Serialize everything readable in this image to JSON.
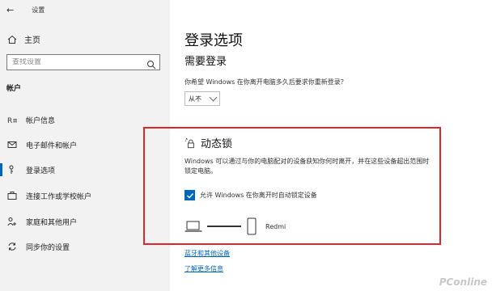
{
  "window": {
    "title": "设置"
  },
  "sidebar": {
    "home_label": "主页",
    "search_placeholder": "查找设置",
    "section_label": "帐户",
    "items": [
      {
        "label": "帐户信息",
        "icon": "person-card-icon",
        "active": false
      },
      {
        "label": "电子邮件和帐户",
        "icon": "mail-icon",
        "active": false
      },
      {
        "label": "登录选项",
        "icon": "key-icon",
        "active": true
      },
      {
        "label": "连接工作或学校帐户",
        "icon": "briefcase-icon",
        "active": false
      },
      {
        "label": "家庭和其他用户",
        "icon": "people-icon",
        "active": false
      },
      {
        "label": "同步你的设置",
        "icon": "sync-icon",
        "active": false
      }
    ]
  },
  "main": {
    "title": "登录选项",
    "require_signin": {
      "title": "需要登录",
      "question": "你希望 Windows 在你离开电脑多久后要求你重新登录？",
      "selected": "从不"
    },
    "dynamic_lock": {
      "title": "动态锁",
      "description": "Windows 可以通过与你的电脑配对的设备获知你何时离开，并在这些设备超出范围时锁定电脑。",
      "checkbox_label": "允许 Windows 在你离开时自动锁定设备",
      "checked": true,
      "device_name": "Redmi"
    },
    "links": {
      "bluetooth": "蓝牙和其他设备",
      "learn_more": "了解更多信息"
    }
  },
  "watermark": "PConline",
  "colors": {
    "accent": "#0067c0",
    "highlight": "#e0262b",
    "sidebar_bg": "#f2f2f2"
  }
}
